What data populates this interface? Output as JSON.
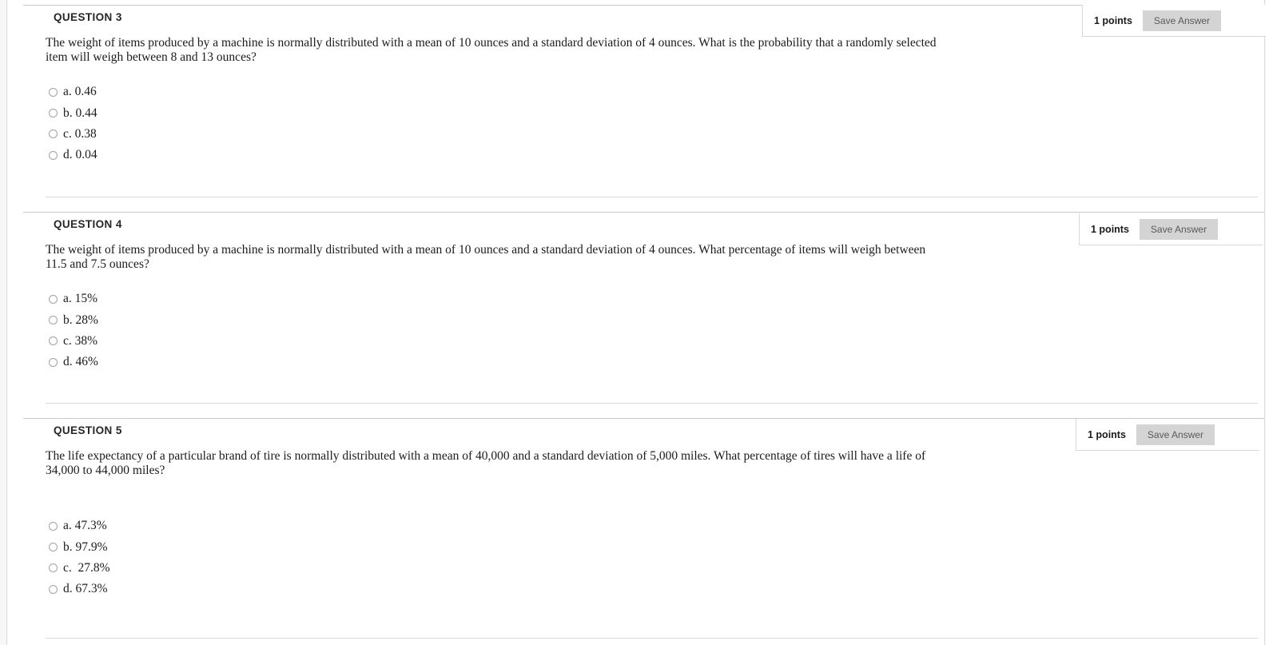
{
  "page": {
    "background": "#ffffff",
    "accent_button_bg": "#d4d4d4"
  },
  "questions": [
    {
      "header": "QUESTION 3",
      "points_label": "1 points",
      "save_label": "Save Answer",
      "text": "The weight of items produced by a machine is normally distributed with a mean of 10 ounces and a standard deviation of 4 ounces.  What is the probability that a randomly selected item will weigh between 8 and 13 ounces?",
      "options": [
        {
          "label": "a. 0.46"
        },
        {
          "label": "b. 0.44"
        },
        {
          "label": "c. 0.38"
        },
        {
          "label": "d. 0.04"
        }
      ]
    },
    {
      "header": "QUESTION 4",
      "points_label": "1 points",
      "save_label": "Save Answer",
      "text": "The weight of items produced by a machine is normally distributed with a mean of 10 ounces and a standard deviation of 4 ounces. What percentage of items will weigh between 11.5 and 7.5 ounces?",
      "options": [
        {
          "label": "a. 15%"
        },
        {
          "label": "b. 28%"
        },
        {
          "label": "c. 38%"
        },
        {
          "label": "d. 46%"
        }
      ]
    },
    {
      "header": "QUESTION 5",
      "points_label": "1 points",
      "save_label": "Save Answer",
      "text": "The life expectancy of a particular brand of tire is normally distributed with a mean of 40,000 and a standard deviation of 5,000 miles. What percentage of tires will have a life of 34,000 to 44,000 miles?",
      "options": [
        {
          "label": "a. 47.3%"
        },
        {
          "label": "b. 97.9%"
        },
        {
          "label": "c.  27.8%"
        },
        {
          "label": "d. 67.3%"
        }
      ]
    }
  ]
}
